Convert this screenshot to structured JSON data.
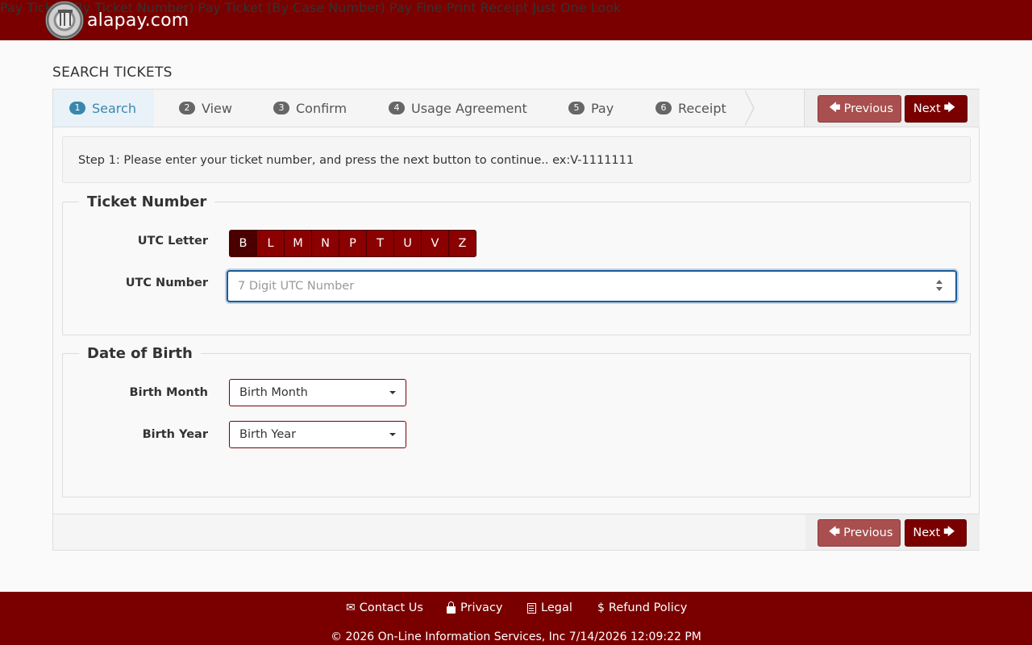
{
  "header": {
    "brand": "alapay.com",
    "nav": [
      {
        "label": "Pay Ticket (By Ticket Number)"
      },
      {
        "label": "Pay Ticket (By Case Number)"
      },
      {
        "label": "Pay Fine"
      },
      {
        "label": "Print Receipt"
      },
      {
        "label": "Just One Look"
      }
    ]
  },
  "page": {
    "title": "SEARCH TICKETS"
  },
  "wizard": {
    "steps": [
      {
        "num": "1",
        "label": "Search"
      },
      {
        "num": "2",
        "label": "View"
      },
      {
        "num": "3",
        "label": "Confirm"
      },
      {
        "num": "4",
        "label": "Usage Agreement"
      },
      {
        "num": "5",
        "label": "Pay"
      },
      {
        "num": "6",
        "label": "Receipt"
      }
    ],
    "active_step": "Search",
    "previous_label": "Previous",
    "next_label": "Next",
    "instructions": "Step 1: Please enter your ticket number, and press the next button to continue.. ex:V-1111111"
  },
  "ticket": {
    "legend": "Ticket Number",
    "utc_letter_label": "UTC Letter",
    "letters": [
      "B",
      "L",
      "M",
      "N",
      "P",
      "T",
      "U",
      "V",
      "Z"
    ],
    "selected_letter": "B",
    "utc_number_label": "UTC Number",
    "utc_number_placeholder": "7 Digit UTC Number",
    "utc_number_value": ""
  },
  "dob": {
    "legend": "Date of Birth",
    "month_label": "Birth Month",
    "month_value": "Birth Month",
    "year_label": "Birth Year",
    "year_value": "Birth Year"
  },
  "footer": {
    "links": [
      {
        "label": "Contact Us",
        "icon": "envelope-icon"
      },
      {
        "label": "Privacy",
        "icon": "lock-icon"
      },
      {
        "label": "Legal",
        "icon": "document-icon"
      },
      {
        "label": "Refund Policy",
        "icon": "dollar-icon"
      }
    ],
    "copyright": "© 2026 On-Line Information Services, Inc 7/14/2026 12:09:22 PM"
  },
  "colors": {
    "brand": "#7a0000",
    "active_step": "#3a87ad",
    "focus_ring": "#1a5a9a"
  }
}
